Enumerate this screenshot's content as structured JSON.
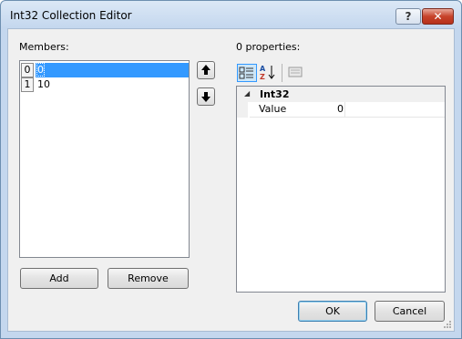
{
  "window": {
    "title": "Int32 Collection Editor",
    "help_glyph": "?",
    "close_glyph": "✕"
  },
  "members": {
    "label": "Members:",
    "items": [
      {
        "index": "0",
        "value": "0",
        "selected": true
      },
      {
        "index": "1",
        "value": "10",
        "selected": false
      }
    ],
    "add_label": "Add",
    "remove_label": "Remove"
  },
  "properties": {
    "label": "0 properties:",
    "category": "Int32",
    "rows": [
      {
        "name": "Value",
        "value": "0"
      }
    ]
  },
  "footer": {
    "ok_label": "OK",
    "cancel_label": "Cancel"
  },
  "icons": {
    "move_up": "arrow-up-icon",
    "move_down": "arrow-down-icon",
    "categorized": "categorized-icon",
    "alphabetical": "alphabetical-sort-icon",
    "property_pages": "property-pages-icon"
  },
  "colors": {
    "selection": "#3399ff",
    "close_button": "#c7432b"
  }
}
